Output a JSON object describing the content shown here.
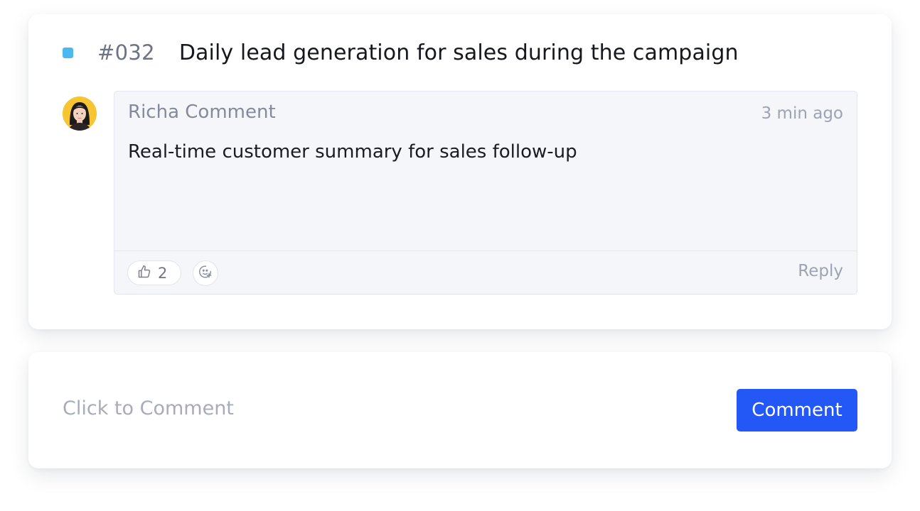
{
  "task": {
    "status_color": "#4cb8f0",
    "id": "#032",
    "title": "Daily lead generation for sales during the campaign"
  },
  "comment": {
    "author": "Richa Comment",
    "time": "3 min ago",
    "text": "Real-time customer summary for sales follow-up",
    "likes": "2",
    "reply_label": "Reply",
    "icons": [
      "thumbs-up-icon",
      "add-emoji-icon"
    ]
  },
  "composer": {
    "placeholder": "Click to Comment",
    "button_label": "Comment",
    "accent": "#2458f6"
  }
}
